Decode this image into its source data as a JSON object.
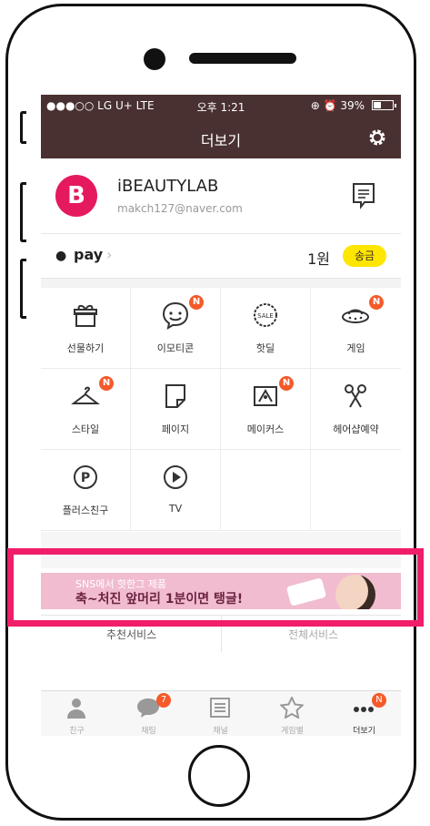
{
  "status_bar": {
    "carrier": "●●●○○ LG U+  LTE",
    "time": "오후 1:21",
    "indicators": "⊕ ⏰ 39%",
    "battery_icon": "battery-icon"
  },
  "nav": {
    "title": "더보기",
    "settings_icon": "gear-icon"
  },
  "profile": {
    "avatar_letter": "B",
    "name": "iBEAUTYLAB",
    "email": "makch127@naver.com",
    "message_icon": "message-icon"
  },
  "pay": {
    "label": "pay",
    "chevron": "›",
    "amount": "1원",
    "send_label": "송금"
  },
  "grid": [
    {
      "label": "선물하기",
      "icon": "gift-icon",
      "badge": ""
    },
    {
      "label": "이모티콘",
      "icon": "emoticon-icon",
      "badge": "N"
    },
    {
      "label": "핫딜",
      "icon": "sale-icon",
      "badge": ""
    },
    {
      "label": "게임",
      "icon": "ufo-icon",
      "badge": "N"
    },
    {
      "label": "스타일",
      "icon": "hanger-icon",
      "badge": "N"
    },
    {
      "label": "페이지",
      "icon": "page-icon",
      "badge": ""
    },
    {
      "label": "메이커스",
      "icon": "makers-icon",
      "badge": "N"
    },
    {
      "label": "헤어샵예약",
      "icon": "scissors-icon",
      "badge": ""
    },
    {
      "label": "플러스친구",
      "icon": "plus-friend-icon",
      "badge": ""
    },
    {
      "label": "TV",
      "icon": "play-icon",
      "badge": ""
    }
  ],
  "banner": {
    "line1": "SNS에서 핫한그 제품",
    "line2": "축~처진 앞머리 1분이면 탱글!"
  },
  "below": {
    "left": "추천서비스",
    "right": "전체서비스"
  },
  "tabs": [
    {
      "label": "친구",
      "icon": "person-icon",
      "badge": ""
    },
    {
      "label": "채팅",
      "icon": "chat-icon",
      "badge": "7"
    },
    {
      "label": "채널",
      "icon": "channel-icon",
      "badge": ""
    },
    {
      "label": "게임별",
      "icon": "star-icon",
      "badge": ""
    },
    {
      "label": "더보기",
      "icon": "more-icon",
      "badge": "N"
    }
  ],
  "colors": {
    "header": "#4a3131",
    "brand_pink": "#e5195e",
    "badge": "#f45a2a",
    "highlight": "#f01e6a",
    "pay_button": "#ffe600"
  }
}
